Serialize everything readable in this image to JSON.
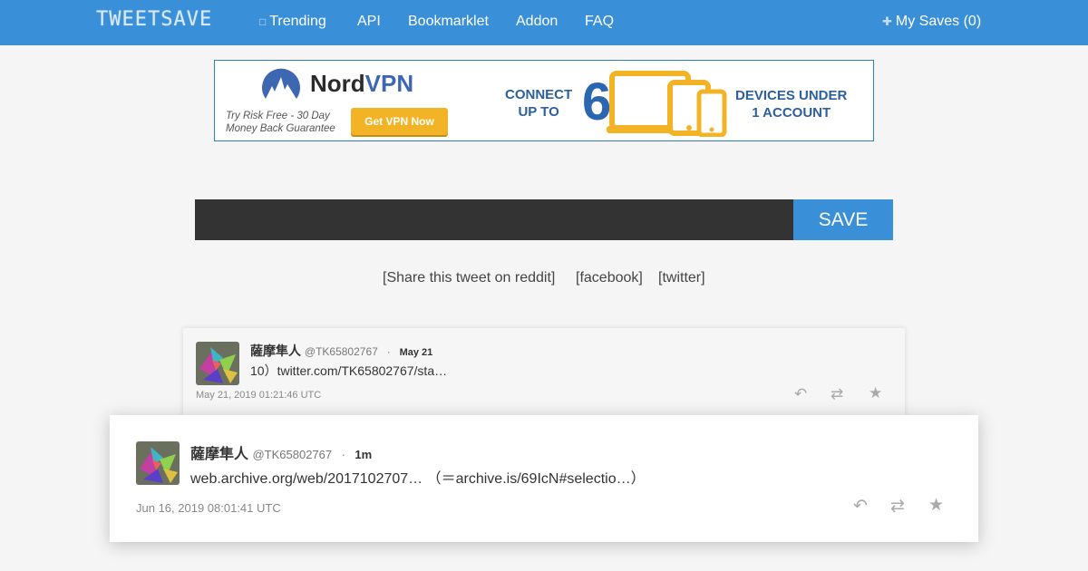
{
  "navbar": {
    "brand": "TWEETSAVE",
    "items": [
      {
        "label": "Trending",
        "icon": "trending-icon"
      },
      {
        "label": "API"
      },
      {
        "label": "Bookmarklet"
      },
      {
        "label": "Addon"
      },
      {
        "label": "FAQ"
      }
    ],
    "my_saves": "My Saves (0)",
    "accent_color": "#3a8fd9"
  },
  "ad": {
    "brand_a": "Nord",
    "brand_b": "VPN",
    "try_line1": "Try Risk Free - 30 Day",
    "try_line2": "Money Back Guarantee",
    "button": "Get VPN Now",
    "connect_line1": "CONNECT",
    "connect_line2": "UP TO",
    "number": "6",
    "devices_line1": "DEVICES UNDER",
    "devices_line2": "1 ACCOUNT"
  },
  "search": {
    "value": "",
    "placeholder": "",
    "button": "SAVE"
  },
  "share": {
    "reddit": "[Share this tweet on reddit]",
    "facebook": "[facebook]",
    "twitter": "[twitter]"
  },
  "tweets": [
    {
      "name": "薩摩隼人",
      "handle": "@TK65802767",
      "separator": "·",
      "date": "May 21",
      "text": "10）twitter.com/TK65802767/sta…",
      "timestamp": "May 21, 2019 01:21:46 UTC"
    },
    {
      "name": "薩摩隼人",
      "handle": "@TK65802767",
      "separator": "·",
      "date": "1m",
      "text": "web.archive.org/web/2017102707… （＝archive.is/69IcN#selectio…）",
      "timestamp": "Jun 16, 2019 08:01:41 UTC"
    }
  ]
}
